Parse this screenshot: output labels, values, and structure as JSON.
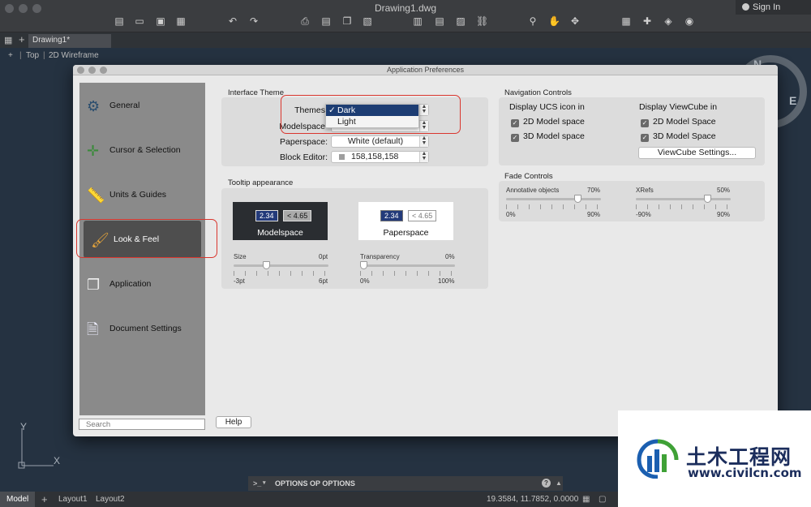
{
  "window": {
    "title": "Drawing1.dwg",
    "sign_in": "Sign In"
  },
  "tabs": {
    "document": "Drawing1*"
  },
  "viewport": {
    "view": "Top",
    "style": "2D Wireframe",
    "compass_n": "N",
    "compass_e": "E",
    "ucs_y": "Y",
    "ucs_x": "X"
  },
  "statusbar": {
    "tabs": [
      "Model",
      "Layout1",
      "Layout2"
    ],
    "coords": "19.3584, 11.7852, 0.0000",
    "command": "OPTIONS OP OPTIONS",
    "prompt": ">_"
  },
  "dialog": {
    "title": "Application Preferences",
    "sidebar": [
      {
        "label": "General",
        "icon": "gear-icon"
      },
      {
        "label": "Cursor & Selection",
        "icon": "cursor-icon"
      },
      {
        "label": "Units & Guides",
        "icon": "ruler-icon"
      },
      {
        "label": "Look & Feel",
        "icon": "brush-icon"
      },
      {
        "label": "Application",
        "icon": "windows-icon"
      },
      {
        "label": "Document Settings",
        "icon": "document-icon"
      }
    ],
    "active_item": "Look & Feel",
    "search_placeholder": "Search",
    "help_label": "Help",
    "interface_theme": {
      "title": "Interface Theme",
      "themes_label": "Themes",
      "theme_options": [
        "Dark",
        "Light"
      ],
      "theme_selected": "Dark",
      "modelspace_label": "Modelspace",
      "paperspace_label": "Paperspace:",
      "paperspace_value": "White (default)",
      "block_editor_label": "Block Editor:",
      "block_editor_value": "158,158,158"
    },
    "tooltip": {
      "title": "Tooltip appearance",
      "modelspace_caption": "Modelspace",
      "paperspace_caption": "Paperspace",
      "sample_a": "2.34",
      "sample_b": "< 4.65",
      "size_label": "Size",
      "size_value": "0pt",
      "size_min": "-3pt",
      "size_max": "6pt",
      "size_level": 0.33,
      "transparency_label": "Transparency",
      "transparency_value": "0%",
      "transparency_min": "0%",
      "transparency_max": "100%",
      "transparency_level": 0
    },
    "navigation": {
      "title": "Navigation Controls",
      "ucs_title": "Display UCS icon in",
      "ucs_2d": "2D Model space",
      "ucs_3d": "3D Model space",
      "vc_title": "Display ViewCube in",
      "vc_2d": "2D Model Space",
      "vc_3d": "3D Model Space",
      "vc_button": "ViewCube Settings..."
    },
    "fade": {
      "title": "Fade Controls",
      "annot_label": "Annotative objects",
      "annot_value": "70%",
      "annot_min": "0%",
      "annot_max": "90%",
      "annot_level": 0.78,
      "xref_label": "XRefs",
      "xref_value": "50%",
      "xref_min": "-90%",
      "xref_max": "90%",
      "xref_level": 0.78
    }
  },
  "watermark": {
    "name": "土木工程网",
    "url": "www.civilcn.com"
  }
}
